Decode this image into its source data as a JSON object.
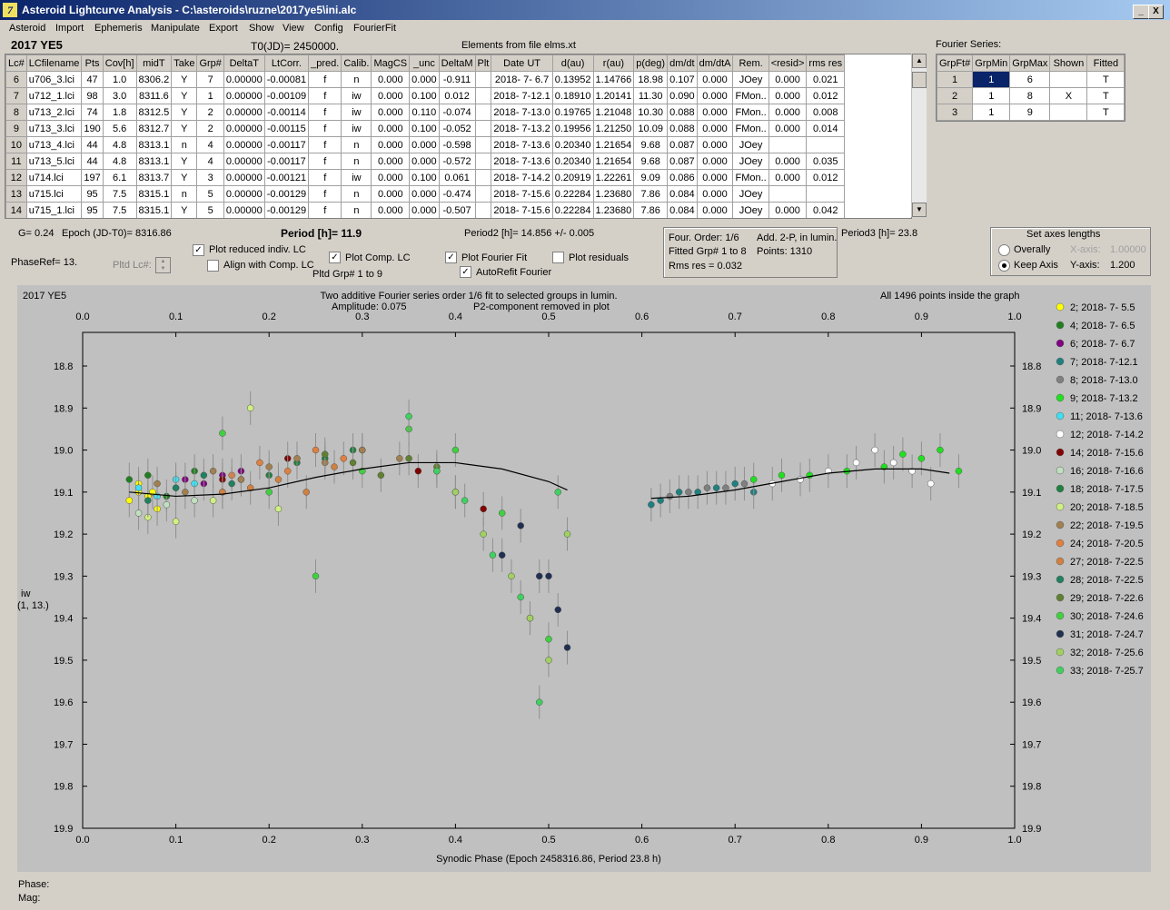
{
  "window": {
    "title": "Asteroid Lightcurve Analysis - C:\\asteroids\\ruzne\\2017ye5\\ini.alc",
    "min": "_",
    "max": "□",
    "close": "X"
  },
  "menu": [
    "Asteroid",
    "Import",
    "Ephemeris",
    "Manipulate",
    "Export",
    "Show",
    "View",
    "Config",
    "FourierFit"
  ],
  "header": {
    "object": "2017 YE5",
    "t0": "T0(JD)= 2450000.",
    "elements": "Elements from file elms.xt",
    "fourier_series_label": "Fourier Series:"
  },
  "lc_table": {
    "columns": [
      "Lc#",
      "LCfilename",
      "Pts",
      "Cov[h]",
      "midT",
      "Take",
      "Grp#",
      "DeltaT",
      "LtCorr.",
      "_pred.",
      "Calib.",
      "MagCS",
      "_unc",
      "DeltaM",
      "Plt",
      "Date UT",
      "d(au)",
      "r(au)",
      "p(deg)",
      "dm/dt",
      "dm/dtA",
      "Rem.",
      "<resid>",
      "rms res"
    ],
    "rows": [
      [
        "6",
        "u706_3.lci",
        "47",
        "1.0",
        "8306.2",
        "Y",
        "7",
        "0.00000",
        "-0.00081",
        "f",
        "n",
        "0.000",
        "0.000",
        "-0.911",
        "",
        "2018- 7- 6.7",
        "0.13952",
        "1.14766",
        "18.98",
        "0.107",
        "0.000",
        "JOey",
        "0.000",
        "0.021"
      ],
      [
        "7",
        "u712_1.lci",
        "98",
        "3.0",
        "8311.6",
        "Y",
        "1",
        "0.00000",
        "-0.00109",
        "f",
        "iw",
        "0.000",
        "0.100",
        "0.012",
        "",
        "2018- 7-12.1",
        "0.18910",
        "1.20141",
        "11.30",
        "0.090",
        "0.000",
        "FMon..",
        "0.000",
        "0.012"
      ],
      [
        "8",
        "u713_2.lci",
        "74",
        "1.8",
        "8312.5",
        "Y",
        "2",
        "0.00000",
        "-0.00114",
        "f",
        "iw",
        "0.000",
        "0.110",
        "-0.074",
        "",
        "2018- 7-13.0",
        "0.19765",
        "1.21048",
        "10.30",
        "0.088",
        "0.000",
        "FMon..",
        "0.000",
        "0.008"
      ],
      [
        "9",
        "u713_3.lci",
        "190",
        "5.6",
        "8312.7",
        "Y",
        "2",
        "0.00000",
        "-0.00115",
        "f",
        "iw",
        "0.000",
        "0.100",
        "-0.052",
        "",
        "2018- 7-13.2",
        "0.19956",
        "1.21250",
        "10.09",
        "0.088",
        "0.000",
        "FMon..",
        "0.000",
        "0.014"
      ],
      [
        "10",
        "u713_4.lci",
        "44",
        "4.8",
        "8313.1",
        "n",
        "4",
        "0.00000",
        "-0.00117",
        "f",
        "n",
        "0.000",
        "0.000",
        "-0.598",
        "",
        "2018- 7-13.6",
        "0.20340",
        "1.21654",
        "9.68",
        "0.087",
        "0.000",
        "JOey",
        "",
        ""
      ],
      [
        "11",
        "u713_5.lci",
        "44",
        "4.8",
        "8313.1",
        "Y",
        "4",
        "0.00000",
        "-0.00117",
        "f",
        "n",
        "0.000",
        "0.000",
        "-0.572",
        "",
        "2018- 7-13.6",
        "0.20340",
        "1.21654",
        "9.68",
        "0.087",
        "0.000",
        "JOey",
        "0.000",
        "0.035"
      ],
      [
        "12",
        "u714.lci",
        "197",
        "6.1",
        "8313.7",
        "Y",
        "3",
        "0.00000",
        "-0.00121",
        "f",
        "iw",
        "0.000",
        "0.100",
        "0.061",
        "",
        "2018- 7-14.2",
        "0.20919",
        "1.22261",
        "9.09",
        "0.086",
        "0.000",
        "FMon..",
        "0.000",
        "0.012"
      ],
      [
        "13",
        "u715.lci",
        "95",
        "7.5",
        "8315.1",
        "n",
        "5",
        "0.00000",
        "-0.00129",
        "f",
        "n",
        "0.000",
        "0.000",
        "-0.474",
        "",
        "2018- 7-15.6",
        "0.22284",
        "1.23680",
        "7.86",
        "0.084",
        "0.000",
        "JOey",
        "",
        ""
      ],
      [
        "14",
        "u715_1.lci",
        "95",
        "7.5",
        "8315.1",
        "Y",
        "5",
        "0.00000",
        "-0.00129",
        "f",
        "n",
        "0.000",
        "0.000",
        "-0.507",
        "",
        "2018- 7-15.6",
        "0.22284",
        "1.23680",
        "7.86",
        "0.084",
        "0.000",
        "JOey",
        "0.000",
        "0.042"
      ]
    ]
  },
  "fourier_table": {
    "columns": [
      "GrpFt#",
      "GrpMin",
      "GrpMax",
      "Shown",
      "Fitted"
    ],
    "rows": [
      [
        "1",
        "1",
        "6",
        "",
        "T"
      ],
      [
        "2",
        "1",
        "8",
        "X",
        "T"
      ],
      [
        "3",
        "1",
        "9",
        "",
        "T"
      ]
    ]
  },
  "controls": {
    "g": "G= 0.24",
    "epoch": "Epoch (JD-T0)= 8316.86",
    "period": "Period [h]= 11.9",
    "period2": "Period2 [h]= 14.856 +/- 0.005",
    "period3": "Period3 [h]= 23.8",
    "phaseref": "PhaseRef= 13.",
    "pltd_lc": "Pltd Lc#:",
    "pltd_grp": "Pltd Grp#  1   to   9",
    "plot_reduced": "Plot reduced indiv. LC",
    "align_comp": "Align with Comp. LC",
    "plot_comp": "Plot Comp. LC",
    "plot_fourier": "Plot Fourier Fit",
    "plot_residuals": "Plot residuals",
    "autorefit": "AutoRefit Fourier",
    "four_order": "Four. Order:  1/6",
    "add_2p": "Add. 2-P, in lumin.",
    "fitted_grp": "Fitted Grp# 1 to 8",
    "points": "Points: 1310",
    "rms_res": "Rms res      = 0.032",
    "axes_title": "Set axes lengths",
    "overally": "Overally",
    "keep_axis": "Keep Axis",
    "xaxis_label": "X-axis:",
    "xaxis_val": "1.00000",
    "yaxis_label": "Y-axis:",
    "yaxis_val": "1.200"
  },
  "chart_data": {
    "type": "scatter",
    "object_label": "2017 YE5",
    "title": "Two additive Fourier series order 1/6 fit to selected groups in lumin.",
    "subtitle_left": "Amplitude: 0.075",
    "subtitle_right": "P2-component removed in plot",
    "points_note": "All 1496 points inside the graph",
    "xlabel": "Synodic Phase (Epoch 2458316.86, Period 23.8 h)",
    "ylabel": "iw",
    "ylabel2": "(1, 13.)",
    "xlim": [
      0.0,
      1.0
    ],
    "ylim": [
      19.9,
      18.72
    ],
    "x_ticks": [
      "0.0",
      "0.1",
      "0.2",
      "0.3",
      "0.4",
      "0.5",
      "0.6",
      "0.7",
      "0.8",
      "0.9",
      "1.0"
    ],
    "y_ticks": [
      "18.8",
      "18.9",
      "19.0",
      "19.1",
      "19.2",
      "19.3",
      "19.4",
      "19.5",
      "19.6",
      "19.7",
      "19.8",
      "19.9"
    ],
    "fit_curve": [
      [
        0.05,
        19.1
      ],
      [
        0.1,
        19.11
      ],
      [
        0.15,
        19.105
      ],
      [
        0.2,
        19.09
      ],
      [
        0.25,
        19.065
      ],
      [
        0.3,
        19.045
      ],
      [
        0.35,
        19.03
      ],
      [
        0.4,
        19.03
      ],
      [
        0.45,
        19.045
      ],
      [
        0.5,
        19.075
      ],
      [
        0.52,
        19.095
      ],
      [
        0.61,
        19.115
      ],
      [
        0.65,
        19.11
      ],
      [
        0.7,
        19.095
      ],
      [
        0.75,
        19.075
      ],
      [
        0.8,
        19.055
      ],
      [
        0.85,
        19.045
      ],
      [
        0.9,
        19.045
      ],
      [
        0.93,
        19.055
      ]
    ],
    "series": [
      {
        "name": "2; 2018- 7- 5.5",
        "color": "#ffff00",
        "x": [
          0.05,
          0.06,
          0.07,
          0.08,
          0.06,
          0.075
        ],
        "y": [
          19.12,
          19.1,
          19.11,
          19.14,
          19.08,
          19.1
        ]
      },
      {
        "name": "4; 2018- 7- 6.5",
        "color": "#208020",
        "x": [
          0.05,
          0.07,
          0.1,
          0.12,
          0.09
        ],
        "y": [
          19.07,
          19.06,
          19.09,
          19.05,
          19.11
        ]
      },
      {
        "name": "6; 2018- 7- 6.7",
        "color": "#800080",
        "x": [
          0.11,
          0.13,
          0.15,
          0.17
        ],
        "y": [
          19.07,
          19.08,
          19.06,
          19.05
        ]
      },
      {
        "name": "7; 2018- 7-12.1",
        "color": "#208080",
        "x": [
          0.61,
          0.62,
          0.64,
          0.66,
          0.68,
          0.7,
          0.72
        ],
        "y": [
          19.13,
          19.12,
          19.1,
          19.1,
          19.09,
          19.08,
          19.1
        ]
      },
      {
        "name": "8; 2018- 7-13.0",
        "color": "#808080",
        "x": [
          0.63,
          0.65,
          0.67,
          0.69,
          0.71
        ],
        "y": [
          19.11,
          19.1,
          19.09,
          19.09,
          19.08
        ]
      },
      {
        "name": "9; 2018- 7-13.2",
        "color": "#20e020",
        "x": [
          0.72,
          0.75,
          0.78,
          0.82,
          0.86,
          0.88,
          0.9,
          0.92,
          0.94
        ],
        "y": [
          19.07,
          19.06,
          19.06,
          19.05,
          19.04,
          19.01,
          19.02,
          19.0,
          19.05
        ]
      },
      {
        "name": "11; 2018- 7-13.6",
        "color": "#40e0f0",
        "x": [
          0.06,
          0.08,
          0.1,
          0.12
        ],
        "y": [
          19.09,
          19.11,
          19.07,
          19.08
        ]
      },
      {
        "name": "12; 2018- 7-14.2",
        "color": "#ffffff",
        "x": [
          0.74,
          0.77,
          0.8,
          0.83,
          0.85,
          0.87,
          0.89,
          0.91
        ],
        "y": [
          19.08,
          19.07,
          19.05,
          19.03,
          19.0,
          19.03,
          19.05,
          19.08
        ]
      },
      {
        "name": "14; 2018- 7-15.6",
        "color": "#800000",
        "x": [
          0.15,
          0.22,
          0.3,
          0.36,
          0.4,
          0.43
        ],
        "y": [
          19.07,
          19.02,
          19.0,
          19.05,
          19.1,
          19.14
        ]
      },
      {
        "name": "16; 2018- 7-16.6",
        "color": "#c0e0c0",
        "x": [
          0.06,
          0.09,
          0.12,
          0.15
        ],
        "y": [
          19.15,
          19.13,
          19.12,
          19.1
        ]
      },
      {
        "name": "18; 2018- 7-17.5",
        "color": "#208040",
        "x": [
          0.17,
          0.2,
          0.23,
          0.26,
          0.29
        ],
        "y": [
          19.07,
          19.06,
          19.03,
          19.02,
          19.0
        ]
      },
      {
        "name": "20; 2018- 7-18.5",
        "color": "#d0f080",
        "x": [
          0.07,
          0.1,
          0.14,
          0.18,
          0.21
        ],
        "y": [
          19.16,
          19.17,
          19.12,
          18.9,
          19.14
        ]
      },
      {
        "name": "22; 2018- 7-19.5",
        "color": "#a08050",
        "x": [
          0.08,
          0.11,
          0.14,
          0.17,
          0.2,
          0.23,
          0.26,
          0.3,
          0.34,
          0.38
        ],
        "y": [
          19.08,
          19.1,
          19.05,
          19.07,
          19.04,
          19.02,
          19.03,
          19.0,
          19.02,
          19.05
        ]
      },
      {
        "name": "24; 2018- 7-20.5",
        "color": "#e08040",
        "x": [
          0.16,
          0.19,
          0.22,
          0.25,
          0.28
        ],
        "y": [
          19.06,
          19.03,
          19.05,
          19.0,
          19.02
        ]
      },
      {
        "name": "27; 2018- 7-22.5",
        "color": "#d08040",
        "x": [
          0.15,
          0.18,
          0.21,
          0.24,
          0.27
        ],
        "y": [
          19.1,
          19.09,
          19.07,
          19.1,
          19.04
        ]
      },
      {
        "name": "28; 2018- 7-22.5",
        "color": "#208060",
        "x": [
          0.07,
          0.1,
          0.13,
          0.16
        ],
        "y": [
          19.12,
          19.09,
          19.06,
          19.08
        ]
      },
      {
        "name": "29; 2018- 7-22.6",
        "color": "#608030",
        "x": [
          0.26,
          0.29,
          0.32,
          0.35,
          0.38
        ],
        "y": [
          19.01,
          19.03,
          19.06,
          19.02,
          19.04
        ]
      },
      {
        "name": "30; 2018- 7-24.6",
        "color": "#40d040",
        "x": [
          0.15,
          0.2,
          0.25,
          0.3,
          0.35,
          0.4,
          0.45,
          0.48,
          0.5
        ],
        "y": [
          18.96,
          19.1,
          19.3,
          19.05,
          18.95,
          19.0,
          19.15,
          19.4,
          19.45
        ]
      },
      {
        "name": "31; 2018- 7-24.7",
        "color": "#203050",
        "x": [
          0.45,
          0.47,
          0.49,
          0.5,
          0.51,
          0.52
        ],
        "y": [
          19.25,
          19.18,
          19.3,
          19.3,
          19.38,
          19.47
        ]
      },
      {
        "name": "32; 2018- 7-25.6",
        "color": "#a0d060",
        "x": [
          0.4,
          0.43,
          0.46,
          0.48,
          0.5,
          0.52
        ],
        "y": [
          19.1,
          19.2,
          19.3,
          19.4,
          19.5,
          19.2
        ]
      },
      {
        "name": "33; 2018- 7-25.7",
        "color": "#40d060",
        "x": [
          0.35,
          0.38,
          0.41,
          0.44,
          0.47,
          0.49,
          0.51
        ],
        "y": [
          18.92,
          19.05,
          19.12,
          19.25,
          19.35,
          19.6,
          19.1
        ]
      }
    ]
  },
  "statusbar": {
    "phase": "Phase:",
    "mag": "Mag:"
  }
}
